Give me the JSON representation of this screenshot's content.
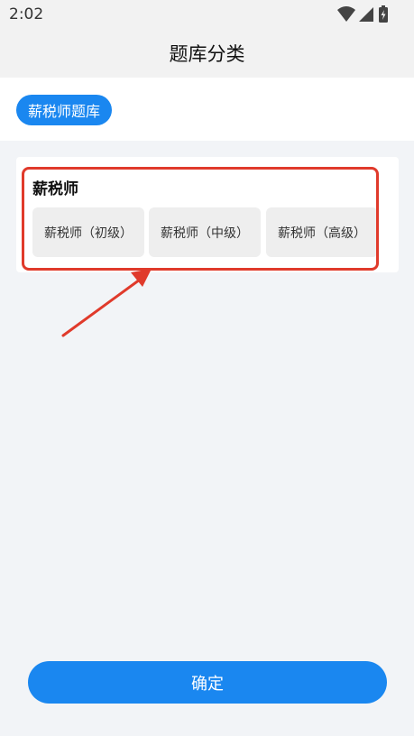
{
  "status_bar": {
    "time": "2:02",
    "icons": [
      "wifi-icon",
      "signal-icon",
      "battery-icon"
    ]
  },
  "header": {
    "title": "题库分类"
  },
  "tabs": [
    {
      "label": "薪税师题库",
      "selected": true
    }
  ],
  "category": {
    "title": "薪税师",
    "options": [
      "薪税师（初级）",
      "薪税师（中级）",
      "薪税师（高级）"
    ]
  },
  "annotation": {
    "color": "#e03a2b"
  },
  "footer": {
    "confirm_label": "确定"
  },
  "colors": {
    "accent": "#1a87f0",
    "background": "#f2f4f7",
    "chip": "#eeeeee",
    "annotation": "#e03a2b"
  }
}
